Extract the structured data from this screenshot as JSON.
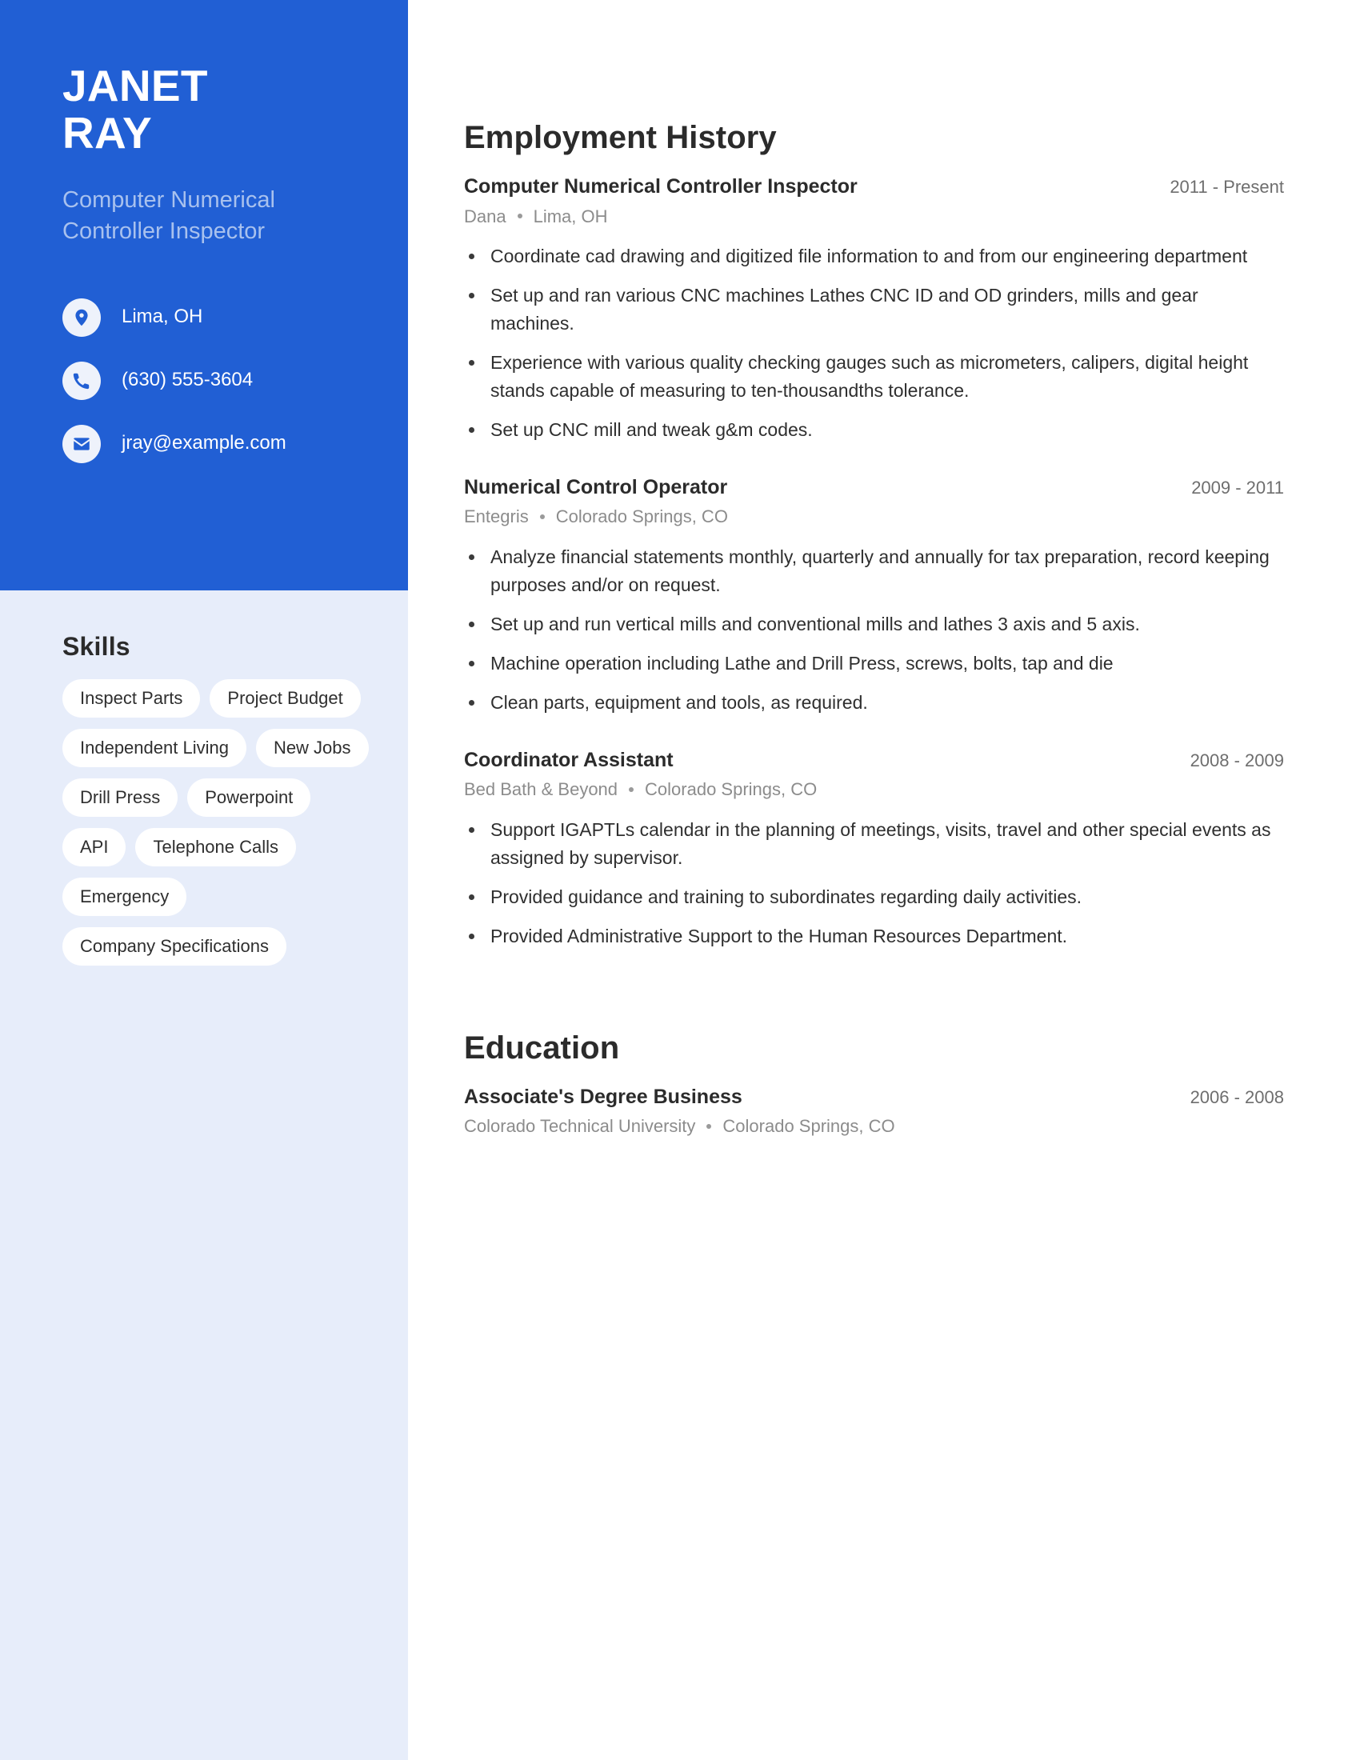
{
  "theme": {
    "accent_blue": "#215fd4",
    "sidebar_light": "#e7edfa",
    "title_muted": "#a8c1ee",
    "chip_bg": "#ffffff",
    "text_dark": "#2b2b2b",
    "text_muted": "#8c8c8c"
  },
  "header": {
    "first_name": "JANET",
    "last_name": "RAY",
    "job_title": "Computer Numerical Controller Inspector"
  },
  "contact": {
    "items": [
      {
        "icon": "location-pin-icon",
        "value": "Lima, OH"
      },
      {
        "icon": "phone-icon",
        "value": "(630) 555-3604"
      },
      {
        "icon": "envelope-icon",
        "value": "jray@example.com"
      }
    ]
  },
  "skills": {
    "heading": "Skills",
    "items": [
      "Inspect Parts",
      "Project Budget",
      "Independent Living",
      "New Jobs",
      "Drill Press",
      "Powerpoint",
      "API",
      "Telephone Calls",
      "Emergency",
      "Company Specifications"
    ]
  },
  "employment": {
    "heading": "Employment History",
    "entries": [
      {
        "role": "Computer Numerical Controller Inspector",
        "dates": "2011 - Present",
        "company": "Dana",
        "location": "Lima, OH",
        "bullets": [
          "Coordinate cad drawing and digitized file information to and from our engineering department",
          "Set up and ran various CNC machines Lathes CNC ID and OD grinders, mills and gear machines.",
          "Experience with various quality checking gauges such as micrometers, calipers, digital height stands capable of measuring to ten-thousandths tolerance.",
          "Set up CNC mill and tweak g&m codes."
        ]
      },
      {
        "role": "Numerical Control Operator",
        "dates": "2009 - 2011",
        "company": "Entegris",
        "location": "Colorado Springs, CO",
        "bullets": [
          "Analyze financial statements monthly, quarterly and annually for tax preparation, record keeping purposes and/or on request.",
          "Set up and run vertical mills and conventional mills and lathes 3 axis and 5 axis.",
          "Machine operation including Lathe and Drill Press, screws, bolts, tap and die",
          "Clean parts, equipment and tools, as required."
        ]
      },
      {
        "role": "Coordinator Assistant",
        "dates": "2008 - 2009",
        "company": "Bed Bath & Beyond",
        "location": "Colorado Springs, CO",
        "bullets": [
          "Support IGAPTLs calendar in the planning of meetings, visits, travel and other special events as assigned by supervisor.",
          "Provided guidance and training to subordinates regarding daily activities.",
          "Provided Administrative Support to the Human Resources Department."
        ]
      }
    ]
  },
  "education": {
    "heading": "Education",
    "entries": [
      {
        "degree": "Associate's Degree Business",
        "dates": "2006 - 2008",
        "school": "Colorado Technical University",
        "location": "Colorado Springs, CO"
      }
    ]
  }
}
